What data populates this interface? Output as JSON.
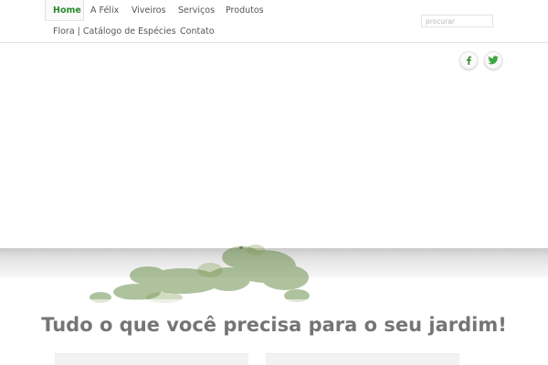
{
  "nav": {
    "items": [
      {
        "label": "Home",
        "active": true
      },
      {
        "label": "A Félix"
      },
      {
        "label": "Viveiros"
      },
      {
        "label": "Serviços"
      },
      {
        "label": "Produtos"
      },
      {
        "label": "Flora | Catálogo de Espécies"
      },
      {
        "label": "Contato"
      }
    ],
    "search_placeholder": "procurar"
  },
  "social": [
    {
      "icon": "facebook-icon"
    },
    {
      "icon": "twitter-icon"
    }
  ],
  "main": {
    "tagline": "Tudo o que você precisa para o seu jardim!"
  },
  "colors": {
    "accent": "#2c8a2c",
    "twitter": "#3fa83f"
  }
}
